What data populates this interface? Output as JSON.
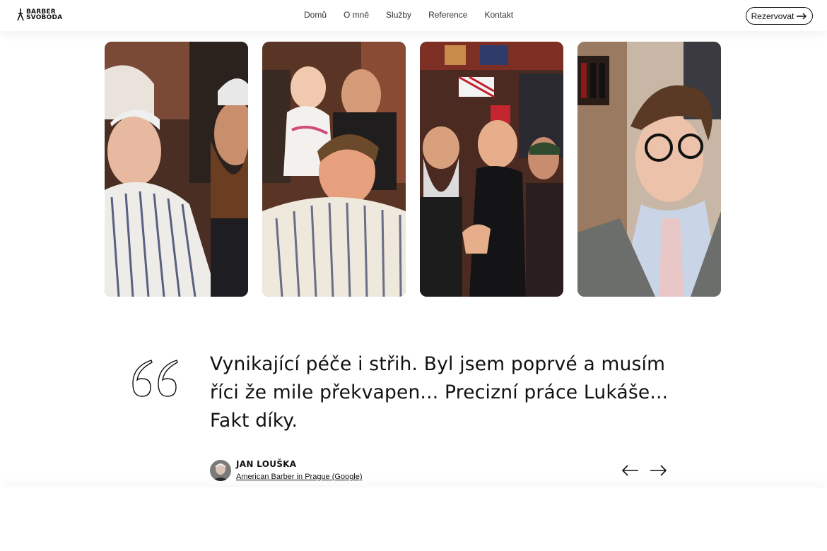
{
  "header": {
    "logo_line1": "BARBER",
    "logo_line2": "SVOBODA",
    "nav": [
      "Domů",
      "O mně",
      "Služby",
      "Reference",
      "Kontakt"
    ],
    "cta_label": "Rezervovat"
  },
  "gallery": {
    "photos": [
      {
        "label": "photo-older-man-and-bearded-barber"
      },
      {
        "label": "photo-baby-and-smiling-client"
      },
      {
        "label": "photo-barbers-selfie-thumbs-up"
      },
      {
        "label": "photo-man-in-glasses-and-vest"
      }
    ]
  },
  "testimonial": {
    "quote": "Vynikající péče i střih. Byl jsem poprvé a musím říci že mile překvapen... Precizní práce Lukáše... Fakt díky.",
    "author_name": "JAN LOUŠKA",
    "author_source": "American Barber in Prague (Google)"
  },
  "icons": {
    "cta_arrow": "arrow-right-icon",
    "prev": "arrow-left-icon",
    "next": "arrow-right-icon",
    "quote": "quote-mark-icon"
  },
  "colors": {
    "text": "#111111",
    "background": "#ffffff"
  }
}
